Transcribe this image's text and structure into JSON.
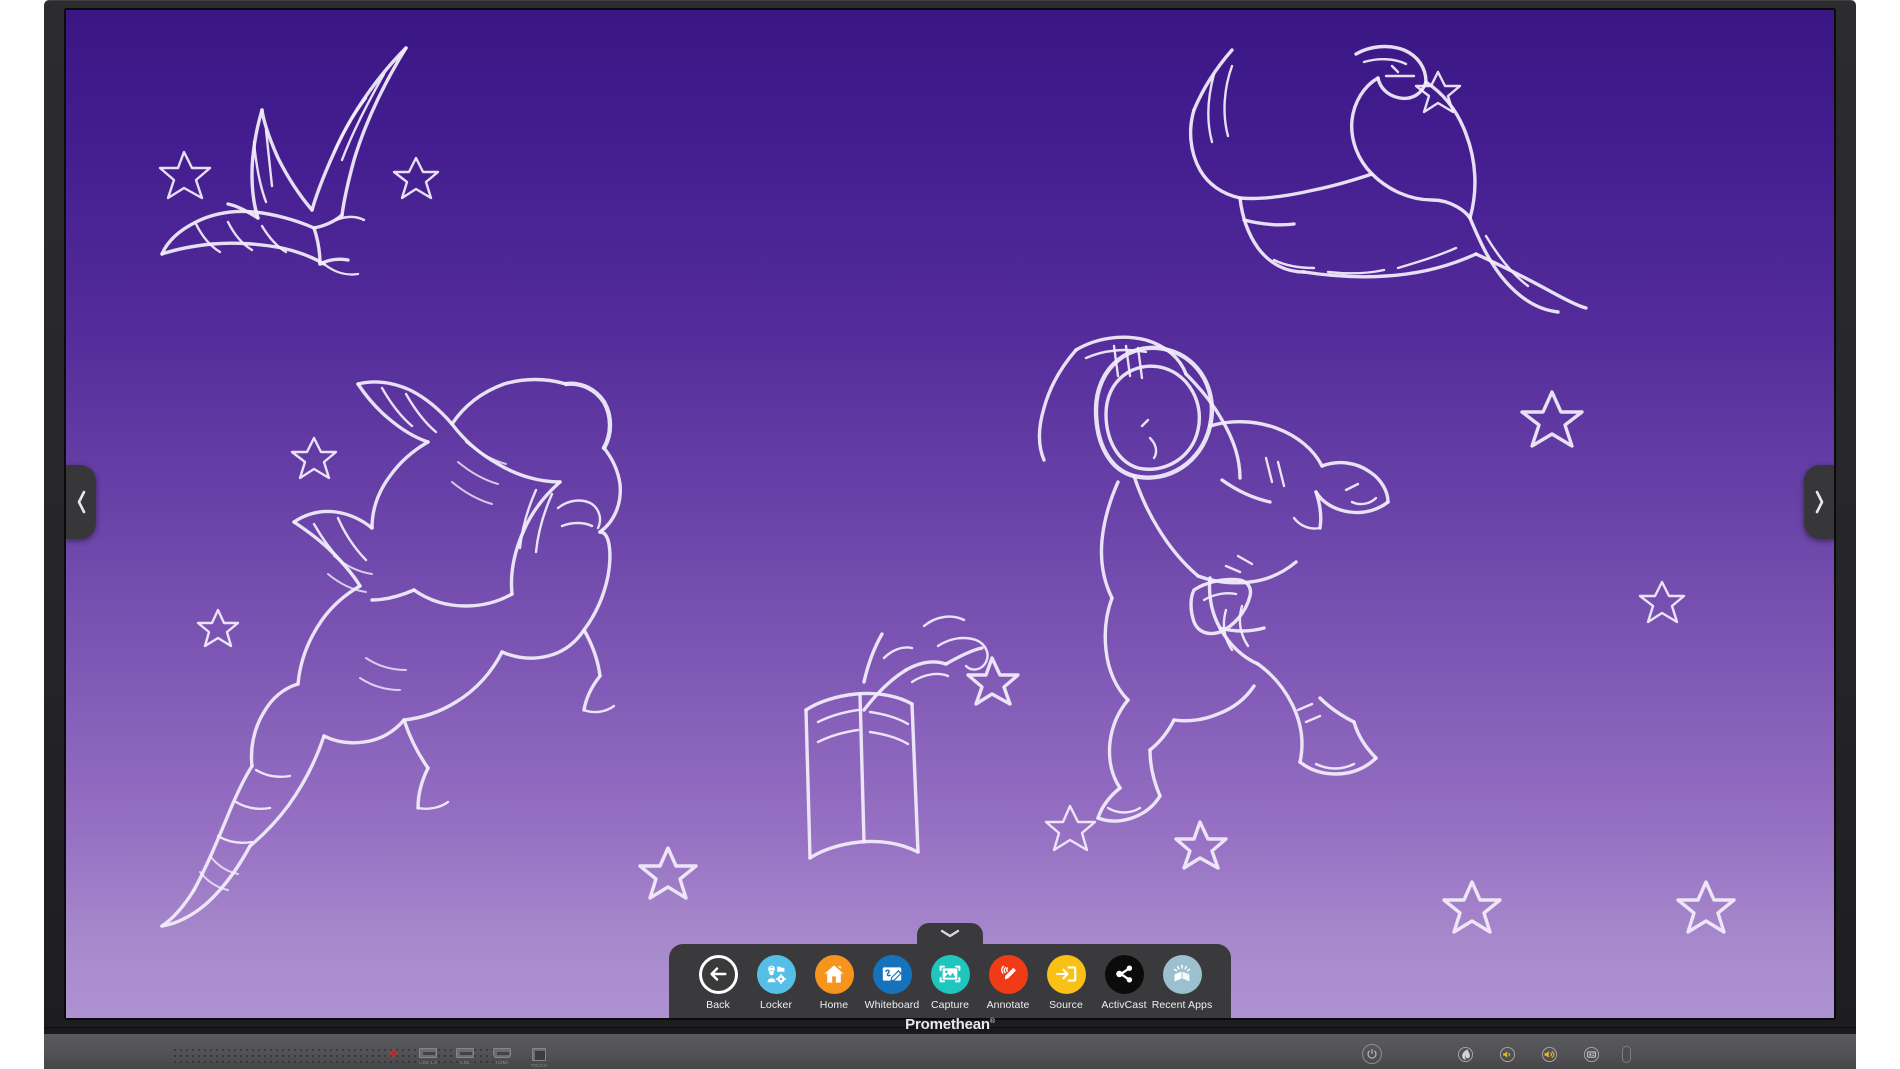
{
  "device": {
    "brand": "Promethean",
    "brand_tm": "®"
  },
  "screen": {
    "background_top_color": "#3a1684",
    "background_bottom_color": "#ad91d0",
    "artwork_description": "white chalk sketches of dinosaurs, an astronaut, an open book and stars on a purple gradient",
    "chalk_color": "#f3eefb"
  },
  "side_handles": {
    "left": {
      "icon": "chevron-left-icon",
      "label": ""
    },
    "right": {
      "icon": "chevron-right-icon",
      "label": ""
    }
  },
  "toolbar": {
    "handle_icon": "chevron-down-icon",
    "background_color": "#3a3a3c",
    "items": [
      {
        "label": "Back",
        "icon": "back-arrow-icon",
        "color": "transparent",
        "style": "outline"
      },
      {
        "label": "Locker",
        "icon": "locker-icon",
        "color": "#56bfe8"
      },
      {
        "label": "Home",
        "icon": "home-icon",
        "color": "#f7941e"
      },
      {
        "label": "Whiteboard",
        "icon": "whiteboard-icon",
        "color": "#1573bd"
      },
      {
        "label": "Capture",
        "icon": "capture-icon",
        "color": "#1fc6bd"
      },
      {
        "label": "Annotate",
        "icon": "annotate-pen-icon",
        "color": "#f03c16"
      },
      {
        "label": "Source",
        "icon": "source-input-icon",
        "color": "#f9c015"
      },
      {
        "label": "ActivCast",
        "icon": "share-nodes-icon",
        "color": "#0b0b0b"
      },
      {
        "label": "Recent Apps",
        "icon": "open-book-icon",
        "color": "#9dc0cf"
      }
    ]
  },
  "bezel_controls": {
    "ports": [
      {
        "label": "USB 3.0",
        "type": "usb"
      },
      {
        "label": "USB",
        "type": "usb"
      },
      {
        "label": "HDMI",
        "type": "hdmi"
      },
      {
        "label": "TOUCH",
        "type": "square"
      }
    ],
    "led": {
      "name": "power-indicator-led",
      "color": "#cc2020"
    },
    "buttons": [
      {
        "name": "power-button",
        "icon": "power-icon",
        "color": "#8e8e92"
      },
      {
        "name": "promethean-flame",
        "icon": "flame-icon",
        "color": "#c9c9cd"
      },
      {
        "name": "volume-down-button",
        "icon": "volume-down-icon",
        "color": "#e8b91e"
      },
      {
        "name": "volume-up-button",
        "icon": "volume-up-icon",
        "color": "#e8b91e"
      },
      {
        "name": "source-button",
        "icon": "display-icon",
        "color": "#b9b9bd"
      }
    ],
    "sensor": {
      "name": "ir-sensor",
      "label": ""
    }
  }
}
